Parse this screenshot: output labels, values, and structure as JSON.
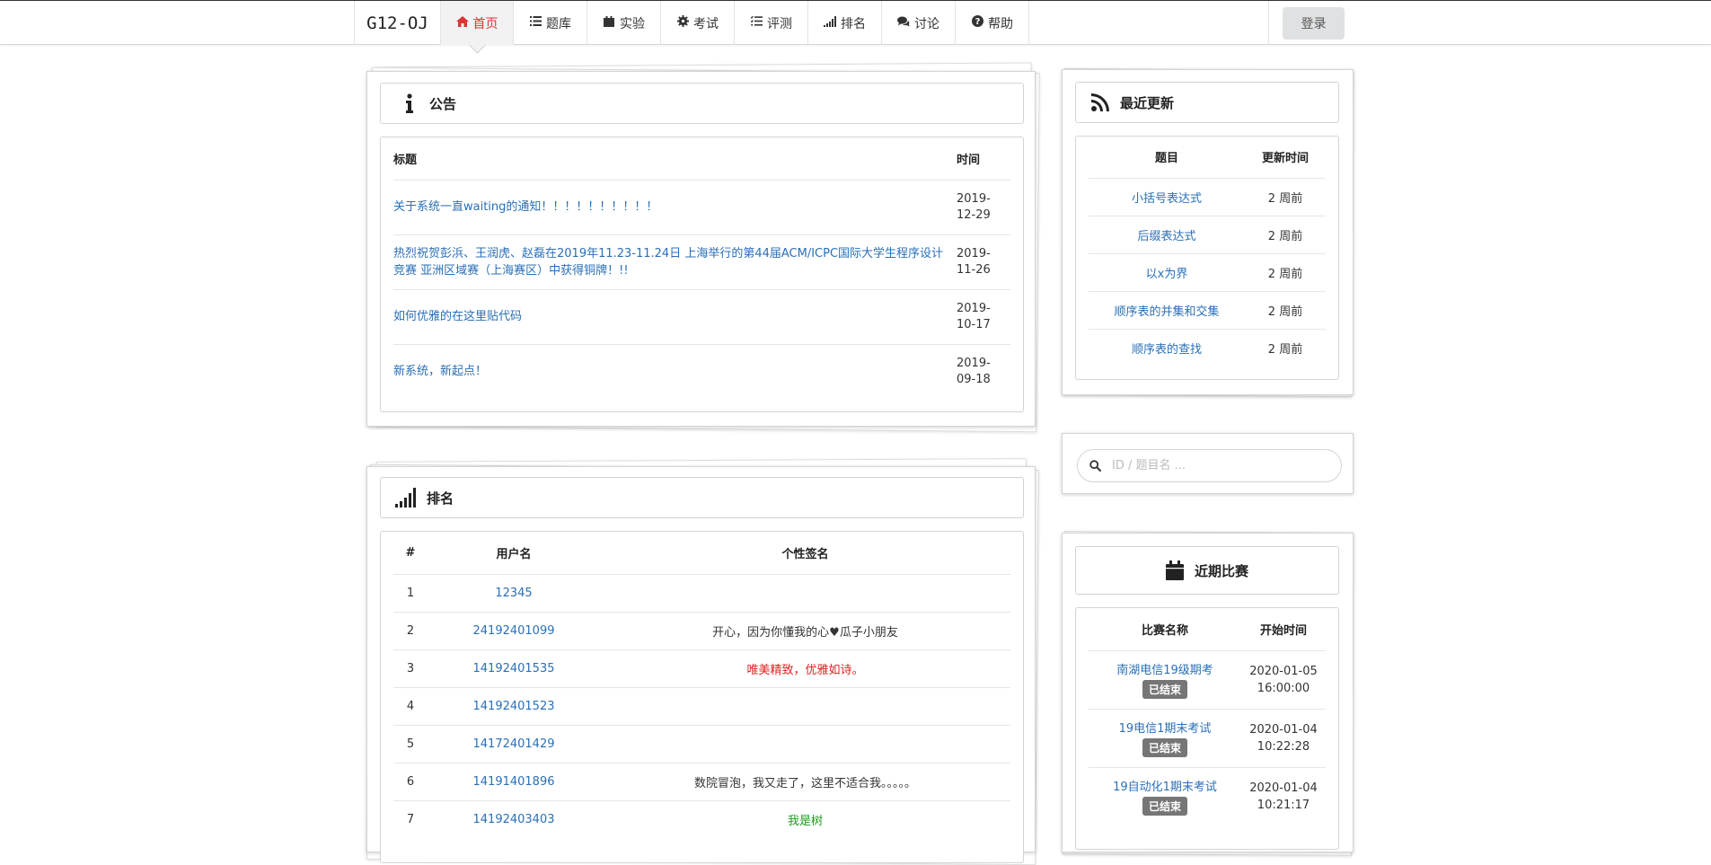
{
  "nav": {
    "brand": "G12-OJ",
    "items": [
      {
        "label": "首页",
        "icon": "home-icon"
      },
      {
        "label": "题库",
        "icon": "list-icon"
      },
      {
        "label": "实验",
        "icon": "calendar-icon"
      },
      {
        "label": "考试",
        "icon": "gear-icon"
      },
      {
        "label": "评测",
        "icon": "tasks-icon"
      },
      {
        "label": "排名",
        "icon": "signal-icon"
      },
      {
        "label": "讨论",
        "icon": "comments-icon"
      },
      {
        "label": "帮助",
        "icon": "question-icon"
      }
    ],
    "login": "登录"
  },
  "notice": {
    "title": "公告",
    "col_title": "标题",
    "col_time": "时间",
    "rows": [
      {
        "title": "关于系统一直waiting的通知！！！！！！！！！！",
        "time": "2019-12-29"
      },
      {
        "title": "热烈祝贺彭浜、王润虎、赵磊在2019年11.23-11.24日 上海举行的第44届ACM/ICPC国际大学生程序设计竞赛 亚洲区域赛（上海赛区）中获得铜牌！!!",
        "time": "2019-11-26"
      },
      {
        "title": "如何优雅的在这里贴代码",
        "time": "2019-10-17"
      },
      {
        "title": "新系统，新起点！",
        "time": "2019-09-18"
      }
    ]
  },
  "rank": {
    "title": "排名",
    "col_no": "#",
    "col_user": "用户名",
    "col_sig": "个性签名",
    "rows": [
      {
        "no": "1",
        "user": "12345",
        "sig": "",
        "color": ""
      },
      {
        "no": "2",
        "user": "24192401099",
        "sig": "开心，因为你懂我的心♥瓜子小朋友",
        "color": ""
      },
      {
        "no": "3",
        "user": "14192401535",
        "sig": "唯美精致，优雅如诗。",
        "color": "red"
      },
      {
        "no": "4",
        "user": "14192401523",
        "sig": "",
        "color": ""
      },
      {
        "no": "5",
        "user": "14172401429",
        "sig": "",
        "color": ""
      },
      {
        "no": "6",
        "user": "14191401896",
        "sig": "数院冒泡，我又走了，这里不适合我。。。。。",
        "color": ""
      },
      {
        "no": "7",
        "user": "14192403403",
        "sig": "我是树",
        "color": "green"
      }
    ]
  },
  "updates": {
    "title": "最近更新",
    "col_problem": "题目",
    "col_time": "更新时间",
    "rows": [
      {
        "name": "小括号表达式",
        "time": "2 周前"
      },
      {
        "name": "后缀表达式",
        "time": "2 周前"
      },
      {
        "name": "以x为界",
        "time": "2 周前"
      },
      {
        "name": "顺序表的并集和交集",
        "time": "2 周前"
      },
      {
        "name": "顺序表的查找",
        "time": "2 周前"
      }
    ]
  },
  "search": {
    "placeholder": "ID / 题目名 ..."
  },
  "contests": {
    "title": "近期比赛",
    "col_name": "比赛名称",
    "col_start": "开始时间",
    "rows": [
      {
        "name": "南湖电信19级期考",
        "status": "已结束",
        "date": "2020-01-05",
        "clock": "16:00:00"
      },
      {
        "name": "19电信1期末考试",
        "status": "已结束",
        "date": "2020-01-04",
        "clock": "10:22:28"
      },
      {
        "name": "19自动化1期末考试",
        "status": "已结束",
        "date": "2020-01-04",
        "clock": "10:21:17"
      }
    ]
  }
}
